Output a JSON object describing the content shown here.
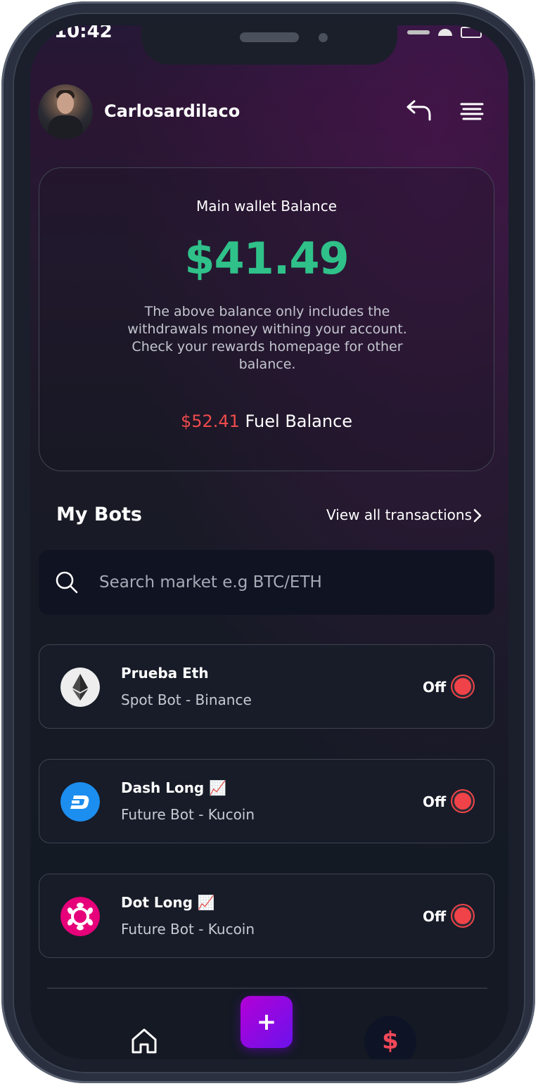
{
  "status_bar": {
    "time": "10:42"
  },
  "user": {
    "name": "Carlosardilaco"
  },
  "balance_card": {
    "title": "Main wallet Balance",
    "amount": "$41.49",
    "note": "The above balance only includes the withdrawals money withing your account. Check your rewards homepage for other balance.",
    "fuel_amount": "$52.41",
    "fuel_label": " Fuel Balance"
  },
  "bots_section": {
    "title": "My Bots",
    "view_all_label": "View all transactions"
  },
  "search": {
    "placeholder": "Search market e.g BTC/ETH",
    "value": ""
  },
  "bots": [
    {
      "name": "Prueba Eth",
      "subtitle": "Spot Bot - Binance",
      "status": "Off",
      "icon": "ethereum-icon"
    },
    {
      "name": "Dash Long 📈",
      "subtitle": "Future Bot - Kucoin",
      "status": "Off",
      "icon": "dash-icon"
    },
    {
      "name": "Dot Long 📈",
      "subtitle": "Future Bot - Kucoin",
      "status": "Off",
      "icon": "polkadot-icon"
    }
  ],
  "tab_bar": {
    "add_label": "+",
    "dollar_label": "$"
  },
  "colors": {
    "accent_green": "#2fc189",
    "accent_red": "#ef4b4b",
    "add_gradient_start": "#b300d6",
    "add_gradient_end": "#6b12ec"
  }
}
